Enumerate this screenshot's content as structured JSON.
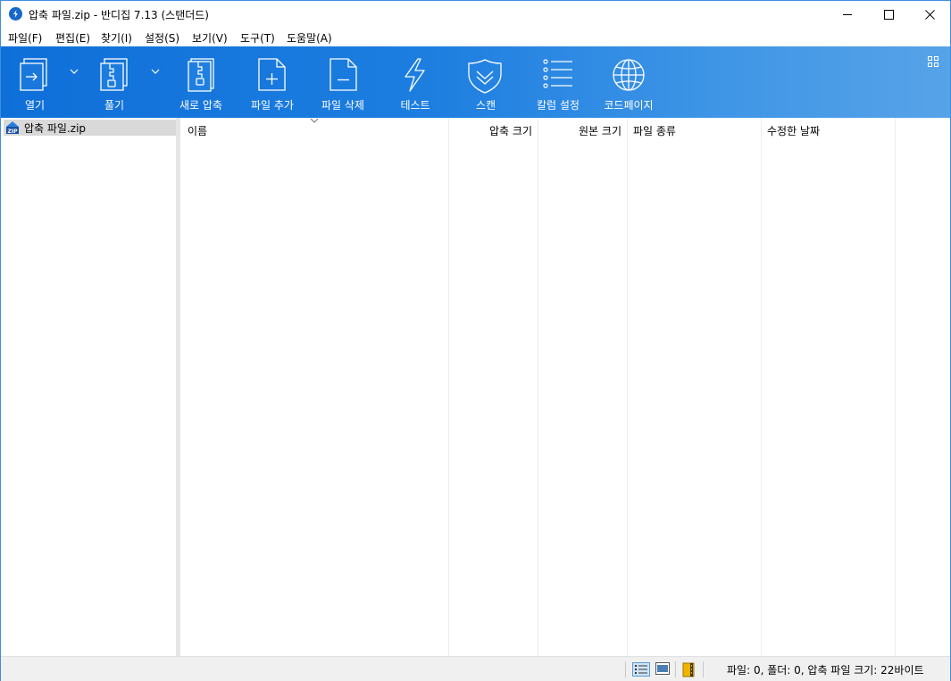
{
  "window": {
    "title": "압축 파일.zip - 반디집 7.13 (스탠더드)"
  },
  "menu": [
    {
      "label": "파일(F)"
    },
    {
      "label": "편집(E)"
    },
    {
      "label": "찾기(I)"
    },
    {
      "label": "설정(S)"
    },
    {
      "label": "보기(V)"
    },
    {
      "label": "도구(T)"
    },
    {
      "label": "도움말(A)"
    }
  ],
  "toolbar": {
    "open_label": "열기",
    "extract_label": "풀기",
    "new_archive_label": "새로 압축",
    "add_file_label": "파일 추가",
    "delete_file_label": "파일 삭제",
    "test_label": "테스트",
    "scan_label": "스캔",
    "columns_label": "칼럼 설정",
    "codepage_label": "코드페이지"
  },
  "tree": {
    "root_label": "압축 파일.zip"
  },
  "list": {
    "columns": [
      {
        "label": "이름"
      },
      {
        "label": "압축 크기"
      },
      {
        "label": "원본 크기"
      },
      {
        "label": "파일 종류"
      },
      {
        "label": "수정한 날짜"
      }
    ]
  },
  "status": {
    "summary": "파일: 0, 폴더: 0, 압축 파일 크기: 22바이트"
  },
  "colors": {
    "toolbar_start": "#0f6fd9",
    "toolbar_end": "#57a3e8",
    "window_border": "#3d8ee0"
  }
}
